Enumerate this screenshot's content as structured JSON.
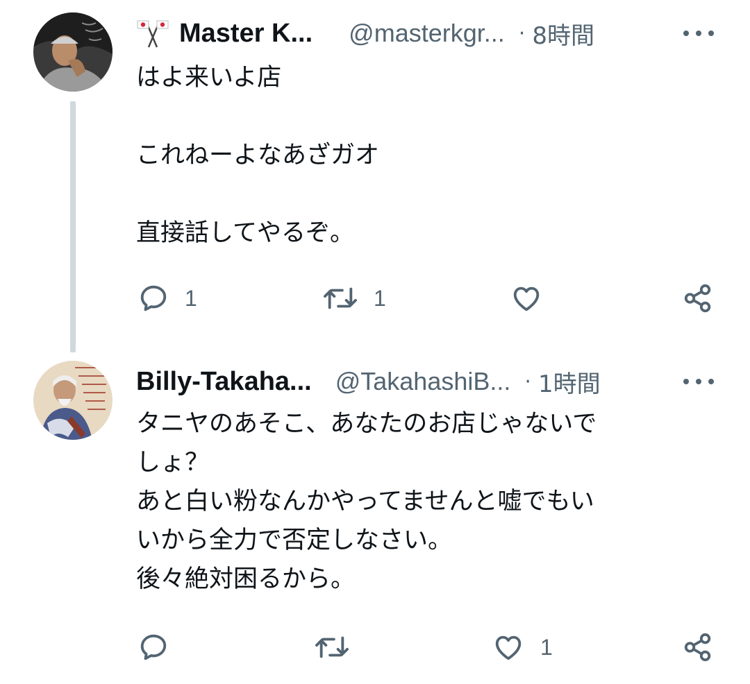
{
  "tweets": [
    {
      "name": "Master K...",
      "handle": "@masterkgr...",
      "separator": "·",
      "time": "8時間",
      "text": "はよ来いよ店\n\nこれねーよなあざガオ\n\n直接話してやるぞ。",
      "reply_count": "1",
      "retweet_count": "1",
      "like_count": ""
    },
    {
      "name": "Billy-Takaha...",
      "handle": "@TakahashiB...",
      "separator": "·",
      "time": "1時間",
      "text": "タニヤのあそこ、あなたのお店じゃないで\nしょ？\nあと白い粉なんかやってませんと嘘でもい\nいから全力で否定しなさい。\n後々絶対困るから。",
      "reply_count": "",
      "retweet_count": "",
      "like_count": "1"
    }
  ],
  "colors": {
    "text": "#0f1419",
    "secondary": "#536471",
    "thread_line": "#cfd9de"
  },
  "icons": [
    "flag-icon",
    "more-icon",
    "reply-icon",
    "retweet-icon",
    "like-icon",
    "share-icon"
  ]
}
